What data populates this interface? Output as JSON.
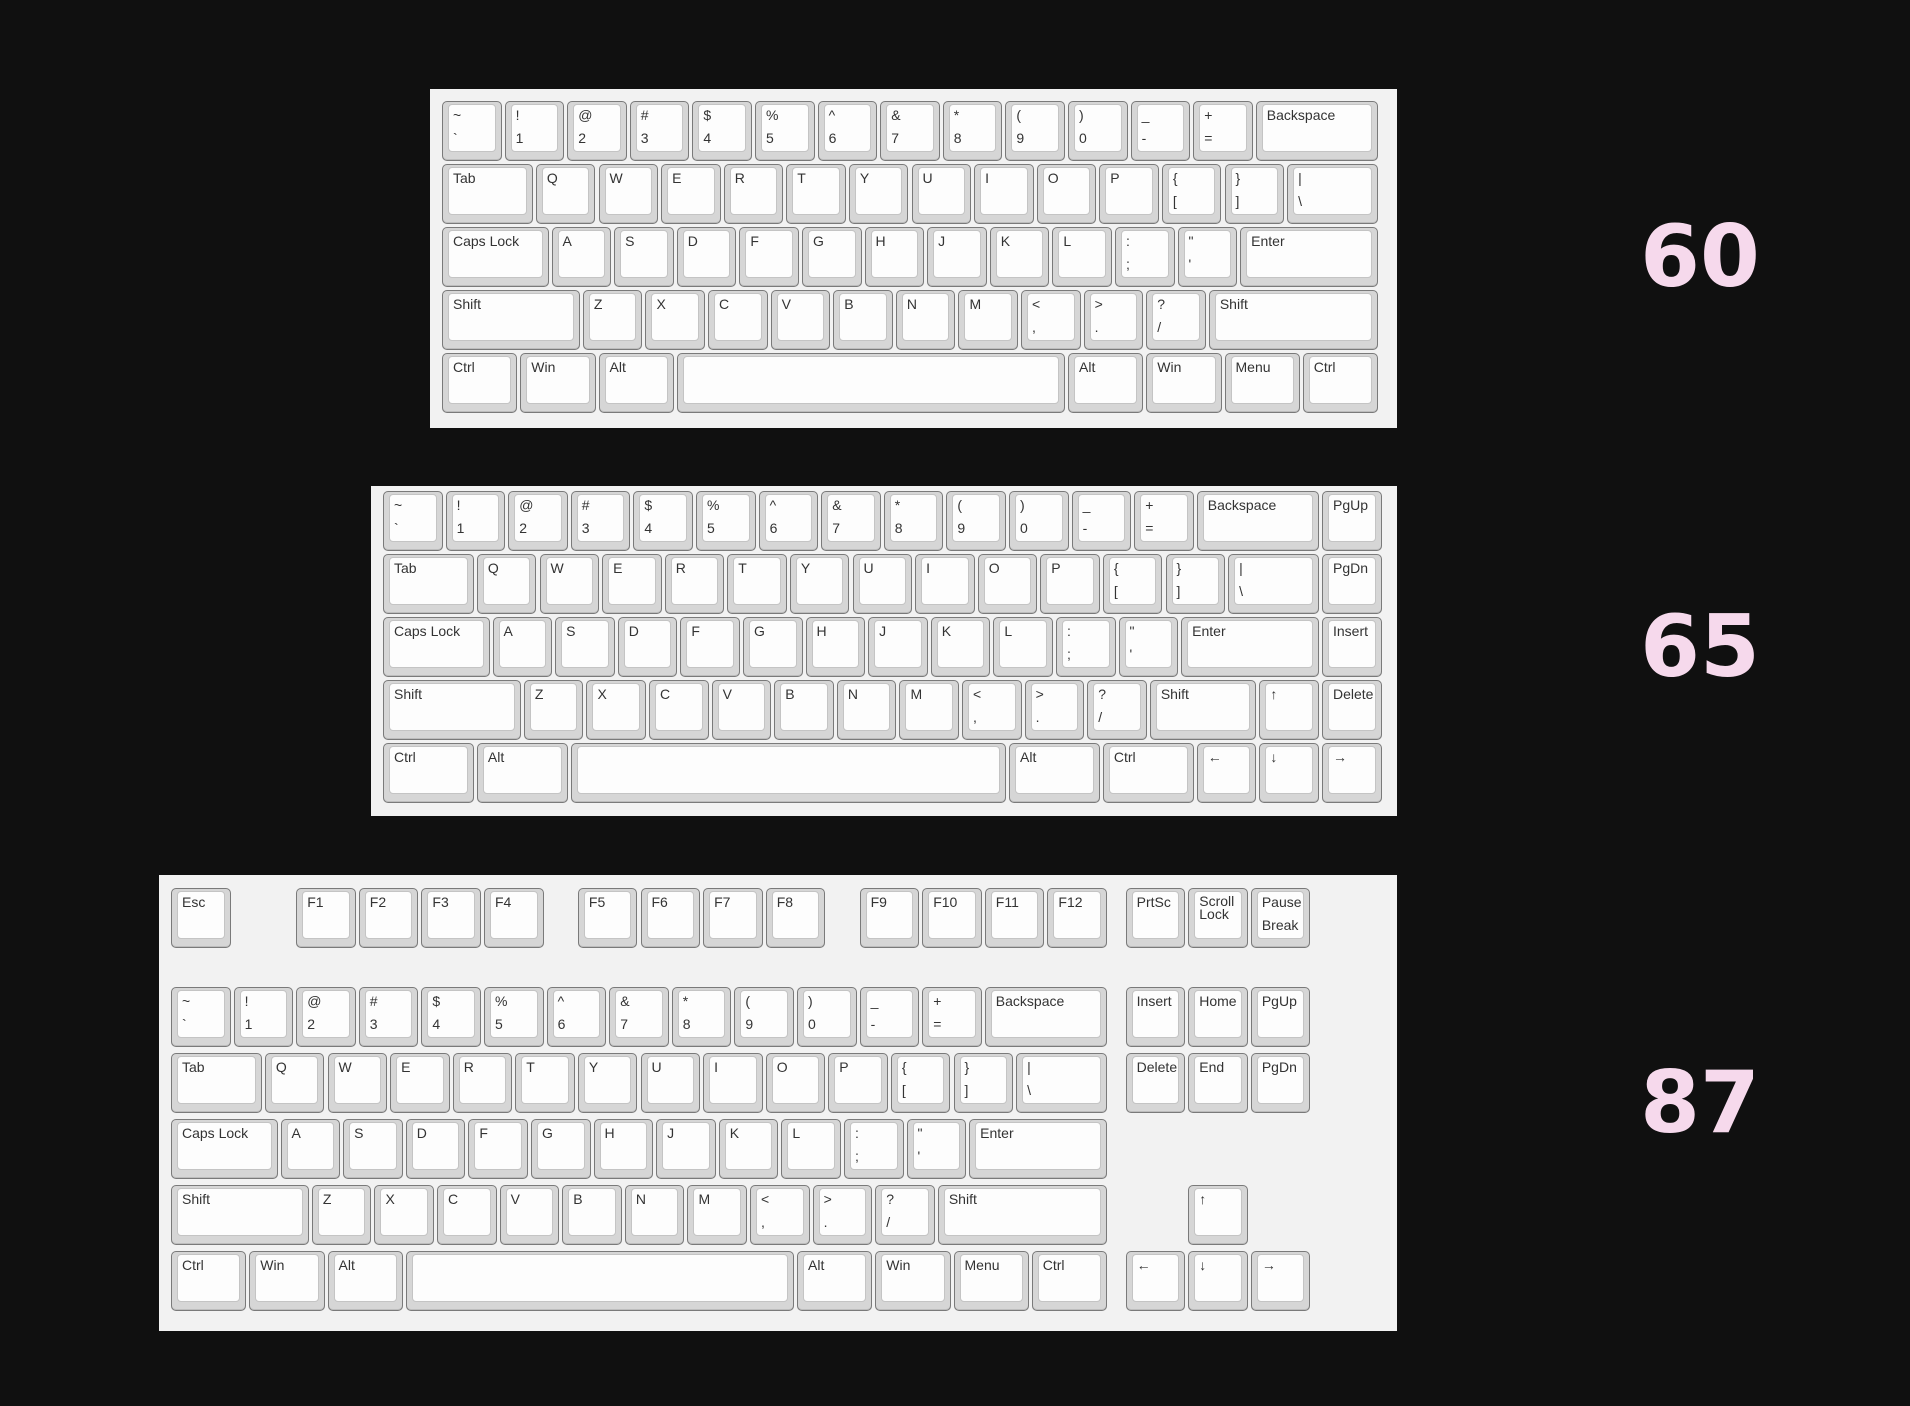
{
  "keyboards": [
    {
      "label": "60",
      "rows": [
        [
          [
            "~",
            "`"
          ],
          [
            "!",
            "1"
          ],
          [
            "@",
            "2"
          ],
          [
            "#",
            "3"
          ],
          [
            "$",
            "4"
          ],
          [
            "%",
            "5"
          ],
          [
            "^",
            "6"
          ],
          [
            "&",
            "7"
          ],
          [
            "*",
            "8"
          ],
          [
            "(",
            "9"
          ],
          [
            ")",
            "0"
          ],
          [
            "_",
            "-"
          ],
          [
            "+",
            "="
          ],
          [
            "Backspace",
            ""
          ]
        ],
        [
          [
            "Tab",
            ""
          ],
          [
            "Q",
            ""
          ],
          [
            "W",
            ""
          ],
          [
            "E",
            ""
          ],
          [
            "R",
            ""
          ],
          [
            "T",
            ""
          ],
          [
            "Y",
            ""
          ],
          [
            "U",
            ""
          ],
          [
            "I",
            ""
          ],
          [
            "O",
            ""
          ],
          [
            "P",
            ""
          ],
          [
            "{",
            "["
          ],
          [
            "}",
            "]"
          ],
          [
            "|",
            "\\"
          ]
        ],
        [
          [
            "Caps Lock",
            ""
          ],
          [
            "A",
            ""
          ],
          [
            "S",
            ""
          ],
          [
            "D",
            ""
          ],
          [
            "F",
            ""
          ],
          [
            "G",
            ""
          ],
          [
            "H",
            ""
          ],
          [
            "J",
            ""
          ],
          [
            "K",
            ""
          ],
          [
            "L",
            ""
          ],
          [
            ":",
            ";"
          ],
          [
            "\"",
            "'"
          ],
          [
            "Enter",
            ""
          ]
        ],
        [
          [
            "Shift",
            ""
          ],
          [
            "Z",
            ""
          ],
          [
            "X",
            ""
          ],
          [
            "C",
            ""
          ],
          [
            "V",
            ""
          ],
          [
            "B",
            ""
          ],
          [
            "N",
            ""
          ],
          [
            "M",
            ""
          ],
          [
            "<",
            ","
          ],
          [
            ">",
            "."
          ],
          [
            "?",
            "/"
          ],
          [
            "Shift",
            ""
          ]
        ],
        [
          [
            "Ctrl",
            ""
          ],
          [
            "Win",
            ""
          ],
          [
            "Alt",
            ""
          ],
          [
            "",
            ""
          ],
          [
            "Alt",
            ""
          ],
          [
            "Win",
            ""
          ],
          [
            "Menu",
            ""
          ],
          [
            "Ctrl",
            ""
          ]
        ]
      ]
    },
    {
      "label": "65",
      "rows": [
        [
          [
            "~",
            "`"
          ],
          [
            "!",
            "1"
          ],
          [
            "@",
            "2"
          ],
          [
            "#",
            "3"
          ],
          [
            "$",
            "4"
          ],
          [
            "%",
            "5"
          ],
          [
            "^",
            "6"
          ],
          [
            "&",
            "7"
          ],
          [
            "*",
            "8"
          ],
          [
            "(",
            "9"
          ],
          [
            ")",
            "0"
          ],
          [
            "_",
            "-"
          ],
          [
            "+",
            "="
          ],
          [
            "Backspace",
            ""
          ],
          [
            "PgUp",
            ""
          ]
        ],
        [
          [
            "Tab",
            ""
          ],
          [
            "Q",
            ""
          ],
          [
            "W",
            ""
          ],
          [
            "E",
            ""
          ],
          [
            "R",
            ""
          ],
          [
            "T",
            ""
          ],
          [
            "Y",
            ""
          ],
          [
            "U",
            ""
          ],
          [
            "I",
            ""
          ],
          [
            "O",
            ""
          ],
          [
            "P",
            ""
          ],
          [
            "{",
            "["
          ],
          [
            "}",
            "]"
          ],
          [
            "|",
            "\\"
          ],
          [
            "PgDn",
            ""
          ]
        ],
        [
          [
            "Caps Lock",
            ""
          ],
          [
            "A",
            ""
          ],
          [
            "S",
            ""
          ],
          [
            "D",
            ""
          ],
          [
            "F",
            ""
          ],
          [
            "G",
            ""
          ],
          [
            "H",
            ""
          ],
          [
            "J",
            ""
          ],
          [
            "K",
            ""
          ],
          [
            "L",
            ""
          ],
          [
            ":",
            ";"
          ],
          [
            "\"",
            "'"
          ],
          [
            "Enter",
            ""
          ],
          [
            "Insert",
            ""
          ]
        ],
        [
          [
            "Shift",
            ""
          ],
          [
            "Z",
            ""
          ],
          [
            "X",
            ""
          ],
          [
            "C",
            ""
          ],
          [
            "V",
            ""
          ],
          [
            "B",
            ""
          ],
          [
            "N",
            ""
          ],
          [
            "M",
            ""
          ],
          [
            "<",
            ","
          ],
          [
            ">",
            "."
          ],
          [
            "?",
            "/"
          ],
          [
            "Shift",
            ""
          ],
          [
            "↑",
            ""
          ],
          [
            "Delete",
            ""
          ]
        ],
        [
          [
            "Ctrl",
            ""
          ],
          [
            "Alt",
            ""
          ],
          [
            "",
            ""
          ],
          [
            "Alt",
            ""
          ],
          [
            "Ctrl",
            ""
          ],
          [
            "←",
            ""
          ],
          [
            "↓",
            ""
          ],
          [
            "→",
            ""
          ]
        ]
      ]
    },
    {
      "label": "87",
      "rows": [
        [
          [
            "Esc",
            ""
          ],
          [
            "F1",
            ""
          ],
          [
            "F2",
            ""
          ],
          [
            "F3",
            ""
          ],
          [
            "F4",
            ""
          ],
          [
            "F5",
            ""
          ],
          [
            "F6",
            ""
          ],
          [
            "F7",
            ""
          ],
          [
            "F8",
            ""
          ],
          [
            "F9",
            ""
          ],
          [
            "F10",
            ""
          ],
          [
            "F11",
            ""
          ],
          [
            "F12",
            ""
          ],
          [
            "PrtSc",
            ""
          ],
          [
            "Scroll\nLock",
            ""
          ],
          [
            "Pause",
            "Break"
          ]
        ],
        [
          [
            "~",
            "`"
          ],
          [
            "!",
            "1"
          ],
          [
            "@",
            "2"
          ],
          [
            "#",
            "3"
          ],
          [
            "$",
            "4"
          ],
          [
            "%",
            "5"
          ],
          [
            "^",
            "6"
          ],
          [
            "&",
            "7"
          ],
          [
            "*",
            "8"
          ],
          [
            "(",
            "9"
          ],
          [
            ")",
            "0"
          ],
          [
            "_",
            "-"
          ],
          [
            "+",
            "="
          ],
          [
            "Backspace",
            ""
          ],
          [
            "Insert",
            ""
          ],
          [
            "Home",
            ""
          ],
          [
            "PgUp",
            ""
          ]
        ],
        [
          [
            "Tab",
            ""
          ],
          [
            "Q",
            ""
          ],
          [
            "W",
            ""
          ],
          [
            "E",
            ""
          ],
          [
            "R",
            ""
          ],
          [
            "T",
            ""
          ],
          [
            "Y",
            ""
          ],
          [
            "U",
            ""
          ],
          [
            "I",
            ""
          ],
          [
            "O",
            ""
          ],
          [
            "P",
            ""
          ],
          [
            "{",
            "["
          ],
          [
            "}",
            "]"
          ],
          [
            "|",
            "\\"
          ],
          [
            "Delete",
            ""
          ],
          [
            "End",
            ""
          ],
          [
            "PgDn",
            ""
          ]
        ],
        [
          [
            "Caps Lock",
            ""
          ],
          [
            "A",
            ""
          ],
          [
            "S",
            ""
          ],
          [
            "D",
            ""
          ],
          [
            "F",
            ""
          ],
          [
            "G",
            ""
          ],
          [
            "H",
            ""
          ],
          [
            "J",
            ""
          ],
          [
            "K",
            ""
          ],
          [
            "L",
            ""
          ],
          [
            ":",
            ";"
          ],
          [
            "\"",
            "'"
          ],
          [
            "Enter",
            ""
          ]
        ],
        [
          [
            "Shift",
            ""
          ],
          [
            "Z",
            ""
          ],
          [
            "X",
            ""
          ],
          [
            "C",
            ""
          ],
          [
            "V",
            ""
          ],
          [
            "B",
            ""
          ],
          [
            "N",
            ""
          ],
          [
            "M",
            ""
          ],
          [
            "<",
            ","
          ],
          [
            ">",
            "."
          ],
          [
            "?",
            "/"
          ],
          [
            "Shift",
            ""
          ],
          [
            "↑",
            ""
          ]
        ],
        [
          [
            "Ctrl",
            ""
          ],
          [
            "Win",
            ""
          ],
          [
            "Alt",
            ""
          ],
          [
            "",
            ""
          ],
          [
            "Alt",
            ""
          ],
          [
            "Win",
            ""
          ],
          [
            "Menu",
            ""
          ],
          [
            "Ctrl",
            ""
          ],
          [
            "←",
            ""
          ],
          [
            "↓",
            ""
          ],
          [
            "→",
            ""
          ]
        ]
      ]
    }
  ]
}
